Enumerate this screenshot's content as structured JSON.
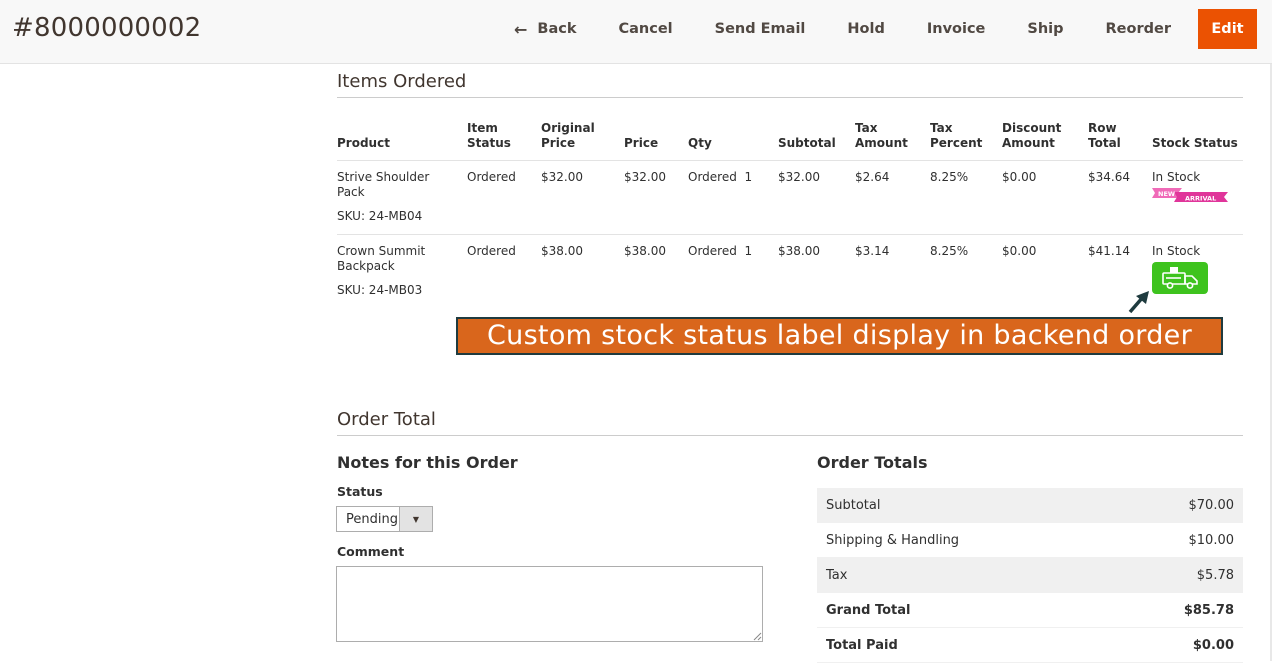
{
  "header": {
    "order_number": "#8000000002",
    "buttons": {
      "back": "Back",
      "cancel": "Cancel",
      "send_email": "Send Email",
      "hold": "Hold",
      "invoice": "Invoice",
      "ship": "Ship",
      "reorder": "Reorder",
      "edit": "Edit"
    }
  },
  "items_ordered": {
    "title": "Items Ordered",
    "columns": [
      "Product",
      "Item Status",
      "Original Price",
      "Price",
      "Qty",
      "Subtotal",
      "Tax Amount",
      "Tax Percent",
      "Discount Amount",
      "Row Total",
      "Stock Status"
    ],
    "rows": [
      {
        "product": "Strive Shoulder Pack",
        "sku": "SKU: 24-MB04",
        "item_status": "Ordered",
        "original_price": "$32.00",
        "price": "$32.00",
        "qty_label": "Ordered",
        "qty": "1",
        "subtotal": "$32.00",
        "tax_amount": "$2.64",
        "tax_percent": "8.25%",
        "discount_amount": "$0.00",
        "row_total": "$34.64",
        "stock_status": "In Stock",
        "badge": {
          "icon": "new-arrival-ribbon-icon",
          "text_top": "NEW",
          "text_bottom": "ARRIVAL",
          "color": "#e0359a"
        }
      },
      {
        "product": "Crown Summit Backpack",
        "sku": "SKU: 24-MB03",
        "item_status": "Ordered",
        "original_price": "$38.00",
        "price": "$38.00",
        "qty_label": "Ordered",
        "qty": "1",
        "subtotal": "$38.00",
        "tax_amount": "$3.14",
        "tax_percent": "8.25%",
        "discount_amount": "$0.00",
        "row_total": "$41.14",
        "stock_status": "In Stock",
        "badge": {
          "icon": "delivery-truck-icon",
          "color": "#3ec31e"
        }
      }
    ]
  },
  "callout": {
    "text": "Custom stock status label display in backend order grid",
    "bg_color": "#d9661c"
  },
  "order_total": {
    "title": "Order Total",
    "notes": {
      "title": "Notes for this Order",
      "status_label": "Status",
      "status_value": "Pending",
      "comment_label": "Comment",
      "comment_value": ""
    },
    "totals": {
      "title": "Order Totals",
      "rows": [
        {
          "label": "Subtotal",
          "value": "$70.00"
        },
        {
          "label": "Shipping & Handling",
          "value": "$10.00"
        },
        {
          "label": "Tax",
          "value": "$5.78"
        },
        {
          "label": "Grand Total",
          "value": "$85.78"
        },
        {
          "label": "Total Paid",
          "value": "$0.00"
        }
      ]
    }
  },
  "colors": {
    "accent": "#eb5202",
    "header_bg": "#f8f8f8"
  }
}
